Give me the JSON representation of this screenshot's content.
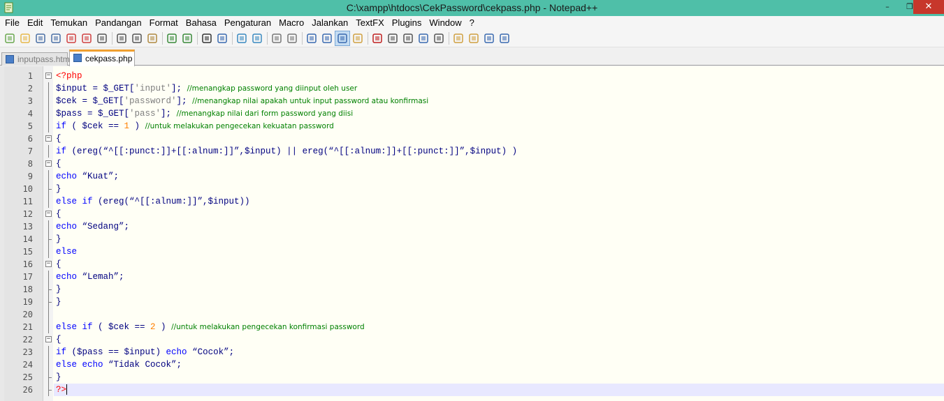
{
  "window": {
    "title": "C:\\xampp\\htdocs\\CekPassword\\cekpass.php - Notepad++",
    "minimize": "–",
    "maximize": "❐",
    "close": "✕"
  },
  "menu": [
    "File",
    "Edit",
    "Temukan",
    "Pandangan",
    "Format",
    "Bahasa",
    "Pengaturan",
    "Macro",
    "Jalankan",
    "TextFX",
    "Plugins",
    "Window",
    "?"
  ],
  "tabs": [
    {
      "label": "inputpass.html",
      "active": false
    },
    {
      "label": "cekpass.php",
      "active": true
    }
  ],
  "toolbar_icons": [
    "new-file-icon",
    "open-file-icon",
    "save-icon",
    "save-all-icon",
    "close-icon",
    "close-all-icon",
    "print-icon",
    "cut-icon",
    "copy-icon",
    "paste-icon",
    "undo-icon",
    "redo-icon",
    "find-icon",
    "replace-icon",
    "zoom-in-icon",
    "zoom-out-icon",
    "sync-vertical-icon",
    "sync-horizontal-icon",
    "word-wrap-icon",
    "show-all-chars-icon",
    "indent-guide-icon",
    "document-map-icon",
    "record-macro-icon",
    "stop-macro-icon",
    "play-macro-icon",
    "run-macro-multiple-icon",
    "save-macro-icon",
    "open-folder-icon",
    "function-list-icon",
    "monitor-icon",
    "spell-check-icon"
  ],
  "editor": {
    "line_numbers": [
      "1",
      "2",
      "3",
      "4",
      "5",
      "6",
      "7",
      "8",
      "9",
      "10",
      "11",
      "12",
      "13",
      "14",
      "15",
      "16",
      "17",
      "18",
      "19",
      "20",
      "21",
      "22",
      "23",
      "24",
      "25",
      "26"
    ],
    "lines": [
      [
        {
          "t": "<?php",
          "c": "tag"
        }
      ],
      [
        {
          "t": "$input = $_GET[",
          "c": ""
        },
        {
          "t": "'input'",
          "c": "str"
        },
        {
          "t": "]; ",
          "c": ""
        },
        {
          "t": "//menangkap password yang diinput oleh user",
          "c": "cm"
        }
      ],
      [
        {
          "t": "$cek = $_GET[",
          "c": ""
        },
        {
          "t": "'password'",
          "c": "str"
        },
        {
          "t": "]; ",
          "c": ""
        },
        {
          "t": "//menangkap nilai apakah untuk input password atau konfirmasi",
          "c": "cm"
        }
      ],
      [
        {
          "t": "$pass = $_GET[",
          "c": ""
        },
        {
          "t": "'pass'",
          "c": "str"
        },
        {
          "t": "]; ",
          "c": ""
        },
        {
          "t": "//menangkap nilai dari form password yang diisi",
          "c": "cm"
        }
      ],
      [
        {
          "t": "if",
          "c": "kw"
        },
        {
          "t": " ( $cek == ",
          "c": ""
        },
        {
          "t": "1",
          "c": "num"
        },
        {
          "t": " ) ",
          "c": ""
        },
        {
          "t": "//untuk melakukan pengecekan kekuatan password",
          "c": "cm"
        }
      ],
      [
        {
          "t": "{",
          "c": ""
        }
      ],
      [
        {
          "t": "if",
          "c": "kw"
        },
        {
          "t": " (ereg(“^[[:punct:]]+[[:alnum:]]”,$input) || ereg(“^[[:alnum:]]+[[:punct:]]”,$input) )",
          "c": ""
        }
      ],
      [
        {
          "t": "{",
          "c": ""
        }
      ],
      [
        {
          "t": "echo",
          "c": "kw"
        },
        {
          "t": " “Kuat”;",
          "c": ""
        }
      ],
      [
        {
          "t": "}",
          "c": ""
        }
      ],
      [
        {
          "t": "else if",
          "c": "kw"
        },
        {
          "t": " (ereg(“^[[:alnum:]]”,$input))",
          "c": ""
        }
      ],
      [
        {
          "t": "{",
          "c": ""
        }
      ],
      [
        {
          "t": "echo",
          "c": "kw"
        },
        {
          "t": " “Sedang”;",
          "c": ""
        }
      ],
      [
        {
          "t": "}",
          "c": ""
        }
      ],
      [
        {
          "t": "else",
          "c": "kw"
        }
      ],
      [
        {
          "t": "{",
          "c": ""
        }
      ],
      [
        {
          "t": "echo",
          "c": "kw"
        },
        {
          "t": " “Lemah”;",
          "c": ""
        }
      ],
      [
        {
          "t": "}",
          "c": ""
        }
      ],
      [
        {
          "t": "}",
          "c": ""
        }
      ],
      [],
      [
        {
          "t": "else if",
          "c": "kw"
        },
        {
          "t": " ( $cek == ",
          "c": ""
        },
        {
          "t": "2",
          "c": "num"
        },
        {
          "t": " ) ",
          "c": ""
        },
        {
          "t": "//untuk melakukan pengecekan konfirmasi password",
          "c": "cm"
        }
      ],
      [
        {
          "t": "{",
          "c": ""
        }
      ],
      [
        {
          "t": "if",
          "c": "kw"
        },
        {
          "t": " ($pass == $input) ",
          "c": ""
        },
        {
          "t": "echo",
          "c": "kw"
        },
        {
          "t": " “Cocok”;",
          "c": ""
        }
      ],
      [
        {
          "t": "else echo",
          "c": "kw"
        },
        {
          "t": " “Tidak Cocok”;",
          "c": ""
        }
      ],
      [
        {
          "t": "}",
          "c": ""
        }
      ],
      [
        {
          "t": "?>",
          "c": "tag"
        }
      ]
    ],
    "current_line": 26
  },
  "colors": {
    "titlebar": "#4fbfa8",
    "close_button": "#c7372b",
    "editor_bg": "#fffff5",
    "current_line_bg": "#e8e8ff",
    "comment": "#008000",
    "keyword": "#0000ff",
    "string": "#808080",
    "number": "#ff8000",
    "php_tag": "#ff0000",
    "active_tab_accent": "#f0a030"
  }
}
